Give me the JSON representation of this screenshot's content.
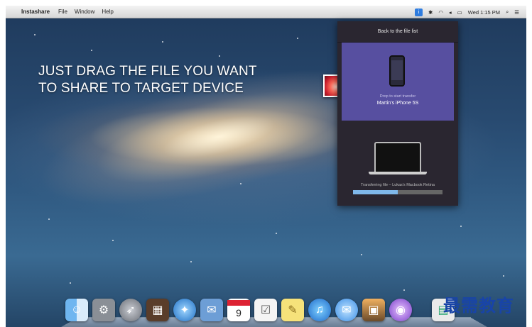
{
  "menubar": {
    "app_name": "Instashare",
    "menus": [
      "File",
      "Window",
      "Help"
    ],
    "clock": "Wed 1:15 PM"
  },
  "headline": {
    "line1": "JUST DRAG THE FILE YOU WANT",
    "line2": "TO SHARE TO TARGET DEVICE"
  },
  "panel": {
    "back_label": "Back to the file list",
    "drop_label": "Drop to start transfer",
    "target_device": "Martin’s iPhone 5S",
    "transfer_label": "Transferring file – Lukas’s Macbook Retina",
    "progress_fraction": 0.5
  },
  "dock": {
    "icons": [
      "finder-icon",
      "system-preferences-icon",
      "launchpad-icon",
      "photo-booth-icon",
      "safari-icon",
      "mail-icon",
      "calendar-icon",
      "reminders-icon",
      "notes-icon",
      "itunes-icon",
      "messages-icon",
      "iphoto-icon",
      "siri-icon",
      "preview-icon"
    ],
    "calendar_day": "9"
  },
  "watermark": "最需教育",
  "colors": {
    "panel_bg": "#2a2630",
    "target_card": "#574fa0",
    "progress": "#7fb8ea",
    "watermark": "#1844a8"
  }
}
